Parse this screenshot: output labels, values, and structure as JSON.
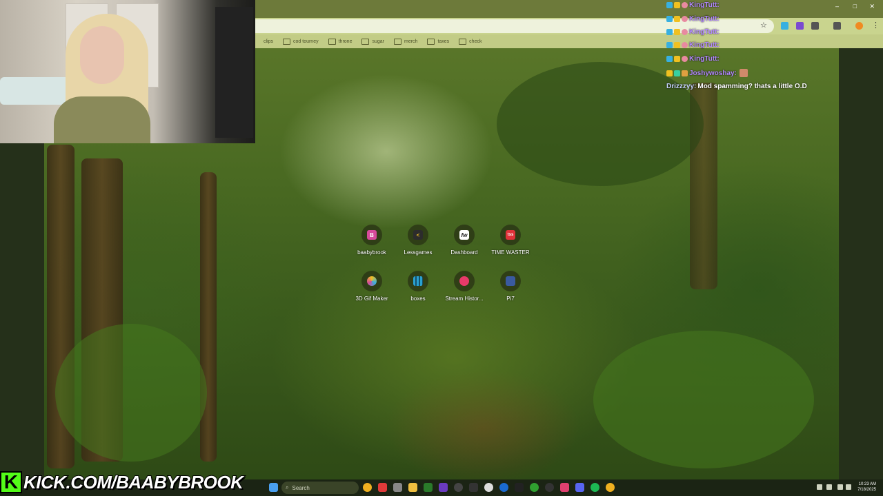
{
  "browser": {
    "bookmarks": [
      "clips",
      "cod tourney",
      "throne",
      "sugar",
      "merch",
      "taxes",
      "check"
    ]
  },
  "shortcuts": [
    {
      "label": "baabybrook",
      "icon": "b-logo-icon",
      "glyph": "B",
      "color": "#d64a9a"
    },
    {
      "label": "Lessgames",
      "icon": "lessgames-icon",
      "glyph": "<",
      "color": "#2c2c2c"
    },
    {
      "label": "Dashboard",
      "icon": "fw-dashboard-icon",
      "glyph": "fw",
      "color": "#ffffff"
    },
    {
      "label": "TIME WASTER",
      "icon": "time-waster-icon",
      "glyph": "tss",
      "color": "#e0323a"
    },
    {
      "label": "3D Gif Maker",
      "icon": "3d-gif-maker-icon",
      "glyph": "",
      "color": "#f0c020"
    },
    {
      "label": "boxes",
      "icon": "boxes-icon",
      "glyph": "",
      "color": "#2aa0d0"
    },
    {
      "label": "Stream Histor...",
      "icon": "stream-history-icon",
      "glyph": "",
      "color": "#e83a6a"
    },
    {
      "label": "Pi7",
      "icon": "pi7-icon",
      "glyph": "",
      "color": "#3a5aa0"
    }
  ],
  "chat": [
    {
      "user": "KingTutt:",
      "message": "",
      "user_color": "#b388ff"
    },
    {
      "user": "KingTutt:",
      "message": "",
      "user_color": "#b388ff"
    },
    {
      "user": "KingTutt:",
      "message": "",
      "user_color": "#b388ff"
    },
    {
      "user": "KingTutt:",
      "message": "",
      "user_color": "#b388ff"
    },
    {
      "user": "KingTutt:",
      "message": "",
      "user_color": "#b388ff"
    },
    {
      "user": "Joshywoshay:",
      "message": "",
      "user_color": "#b388ff"
    },
    {
      "user": "Drizzzyy:",
      "message": "Mod spamming? thats a little O.D",
      "user_color": "#c9d4ff"
    }
  ],
  "taskbar": {
    "search_placeholder": "Search",
    "time": "10:23 AM",
    "date": "7/18/2025"
  },
  "overlay": {
    "kick_letter": "K",
    "kick_url": "KICK.COM/BAABYBROOK"
  },
  "colors": {
    "kick_green": "#53fc18",
    "chat_name": "#b388ff"
  }
}
